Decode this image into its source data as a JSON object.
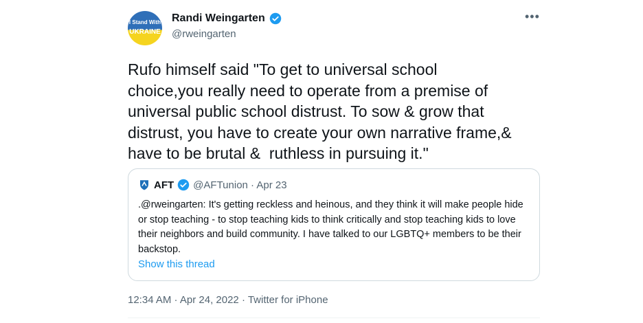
{
  "tweet": {
    "avatar": {
      "line1": "I Stand With",
      "line2": "UKRAINE"
    },
    "display_name": "Randi Weingarten",
    "handle": "@rweingarten",
    "more": "•••",
    "text": "Rufo himself said \"To get to universal school\nchoice,you really need to operate from a premise of\nuniversal public school distrust. To sow & grow that\ndistrust, you have to create your own narrative frame,&\nhave to be brutal &  ruthless in pursuing it.\"",
    "footer": "12:34 AM · Apr 24, 2022 · Twitter for iPhone"
  },
  "quoted": {
    "name": "AFT",
    "meta": "@AFTunion · Apr 23",
    "text": ".@rweingarten: It's getting reckless and heinous, and they think it will make people hide or stop teaching - to stop teaching kids to think critically and stop teaching kids to love their neighbors and build community. I have talked to our LGBTQ+ members to be their backstop.",
    "link": "Show this thread"
  },
  "colors": {
    "verified": "#1d9bf0",
    "link": "#1d9bf0",
    "muted": "#536471"
  }
}
